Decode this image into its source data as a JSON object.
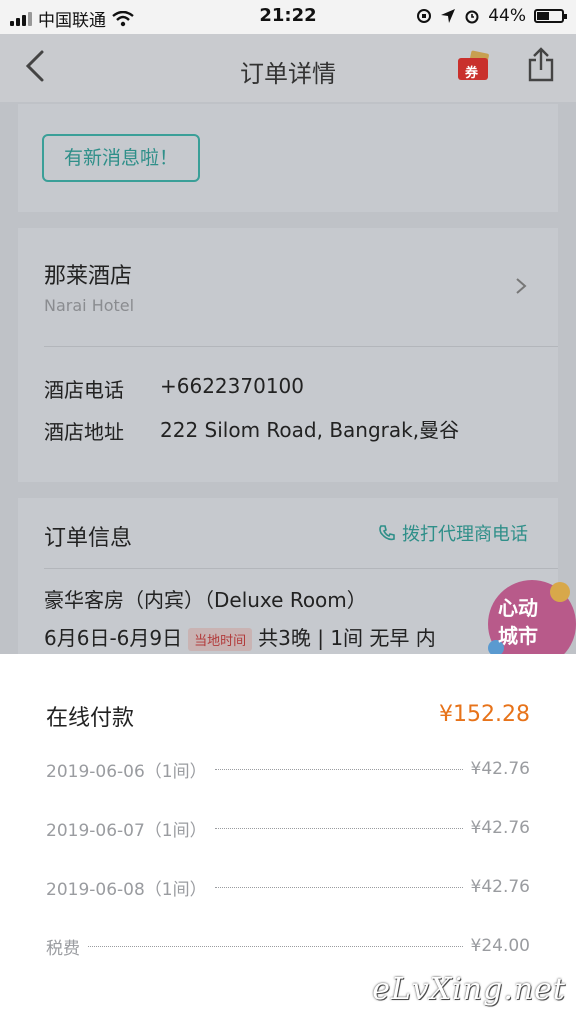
{
  "status_bar": {
    "carrier": "中国联通",
    "time": "21:22",
    "battery": "44%"
  },
  "nav": {
    "title": "订单详情",
    "coupon_label": "券"
  },
  "message_card": {
    "button_label": "有新消息啦！"
  },
  "hotel": {
    "name": "那莱酒店",
    "name_en": "Narai Hotel",
    "phone_label": "酒店电话",
    "phone": "+6622370100",
    "address_label": "酒店地址",
    "address": "222 Silom Road, Bangrak,曼谷"
  },
  "order_info": {
    "title": "订单信息",
    "call_agent": "拨打代理商电话",
    "room": "豪华客房（内宾）（Deluxe Room）",
    "dates": "6月6日-6月9日",
    "local_time_tag": "当地时间",
    "summary": "共3晚 | 1间 无早 内"
  },
  "promo": {
    "line1": "心动",
    "line2": "城市"
  },
  "payment_sheet": {
    "title": "在线付款",
    "total": "¥152.28",
    "items": [
      {
        "label": "2019-06-06（1间）",
        "amount": "¥42.76"
      },
      {
        "label": "2019-06-07（1间）",
        "amount": "¥42.76"
      },
      {
        "label": "2019-06-08（1间）",
        "amount": "¥42.76"
      },
      {
        "label": "税费",
        "amount": "¥24.00"
      }
    ]
  },
  "watermark": "eLvXing.net",
  "colors": {
    "accent_teal": "#2f8f89",
    "price_orange": "#e7731a"
  }
}
